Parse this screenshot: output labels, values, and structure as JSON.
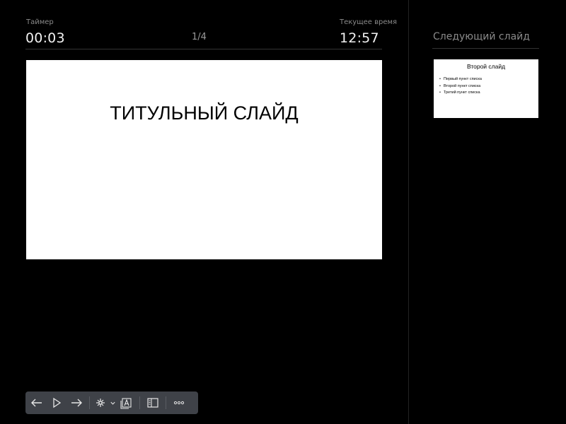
{
  "header": {
    "timer_label": "Таймер",
    "timer_value": "00:03",
    "slide_counter": "1/4",
    "clock_label": "Текущее время",
    "clock_value": "12:57"
  },
  "current_slide": {
    "title": "ТИТУЛЬНЫЙ СЛАЙД"
  },
  "next_slide": {
    "heading": "Следующий слайд",
    "title": "Второй слайд",
    "bullets": [
      "Первый пункт списка",
      "Второй пункт списка",
      "Третий пункт списка"
    ]
  },
  "toolbar": {
    "icons": [
      "arrow-left-icon",
      "play-icon",
      "arrow-right-icon",
      "pointer-icon",
      "chevron-down-icon",
      "text-icon",
      "sidebar-icon",
      "more-icon"
    ]
  },
  "colors": {
    "background": "#000000",
    "toolbar": "#3f4248",
    "slide": "#ffffff"
  }
}
